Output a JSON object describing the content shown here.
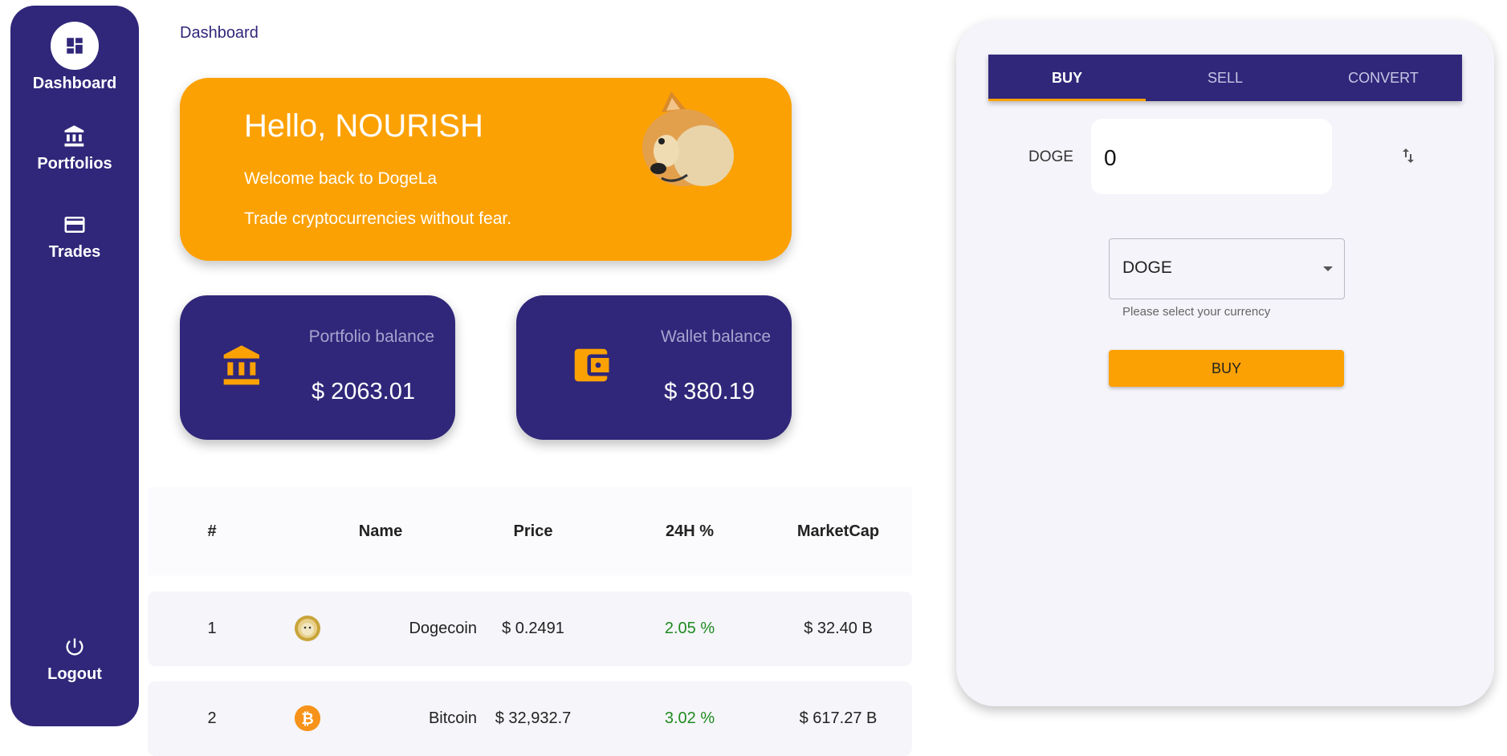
{
  "sidebar": {
    "items": [
      {
        "label": "Dashboard",
        "icon": "dashboard-icon"
      },
      {
        "label": "Portfolios",
        "icon": "bank-icon"
      },
      {
        "label": "Trades",
        "icon": "credit-card-icon"
      }
    ],
    "logout": {
      "label": "Logout",
      "icon": "power-icon"
    }
  },
  "breadcrumb": "Dashboard",
  "hero": {
    "title": "Hello, NOURISH",
    "subtitle": "Welcome back to DogeLa",
    "tagline": "Trade cryptocurrencies without fear."
  },
  "balances": {
    "portfolio": {
      "label": "Portfolio balance",
      "value": "$ 2063.01"
    },
    "wallet": {
      "label": "Wallet balance",
      "value": "$ 380.19"
    }
  },
  "table": {
    "headers": [
      "#",
      "Name",
      "Price",
      "24H %",
      "MarketCap"
    ],
    "rows": [
      {
        "rank": "1",
        "name": "Dogecoin",
        "price": "$ 0.2491",
        "change": "2.05 %",
        "marketcap": "$ 32.40 B",
        "icon": "dogecoin-icon"
      },
      {
        "rank": "2",
        "name": "Bitcoin",
        "price": "$ 32,932.7",
        "change": "3.02 %",
        "marketcap": "$ 617.27 B",
        "icon": "bitcoin-icon"
      }
    ]
  },
  "trade_panel": {
    "tabs": [
      "BUY",
      "SELL",
      "CONVERT"
    ],
    "active_tab": "BUY",
    "amount_label": "DOGE",
    "amount_value": "0",
    "currency_select": "DOGE",
    "helper_text": "Please select your currency",
    "submit_label": "BUY"
  },
  "colors": {
    "primary": "#30277a",
    "accent": "#fca103",
    "positive": "#1f8a1f"
  }
}
